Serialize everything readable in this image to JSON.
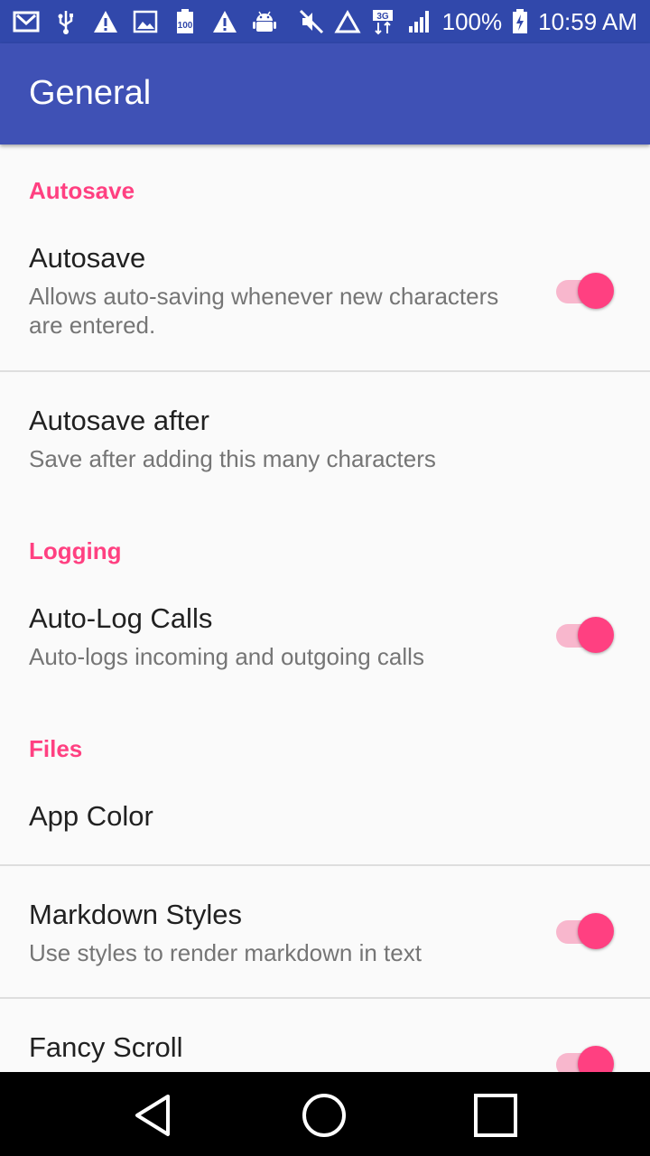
{
  "status_bar": {
    "left_icons": [
      "gmail-icon",
      "usb-icon",
      "warning-icon",
      "image-icon",
      "battery-100-icon",
      "warning-icon",
      "android-icon"
    ],
    "right_icons": [
      "mute-icon",
      "signal-triangle-icon",
      "3g-data-icon",
      "signal-bars-icon"
    ],
    "network_type": "3G",
    "battery_percent": "100%",
    "time": "10:59 AM"
  },
  "app_bar": {
    "title": "General"
  },
  "sections": [
    {
      "header": "Autosave",
      "items": [
        {
          "title": "Autosave",
          "summary": "Allows auto-saving whenever new characters are entered.",
          "switch_on": true
        },
        {
          "title": "Autosave after",
          "summary": "Save after adding this many characters"
        }
      ]
    },
    {
      "header": "Logging",
      "items": [
        {
          "title": "Auto-Log Calls",
          "summary": "Auto-logs incoming and outgoing calls",
          "switch_on": true
        }
      ]
    },
    {
      "header": "Files",
      "items": [
        {
          "title": "App Color"
        },
        {
          "title": "Markdown Styles",
          "summary": "Use styles to render markdown in text",
          "switch_on": true
        },
        {
          "title": "Fancy Scroll",
          "switch_on": true
        }
      ]
    }
  ],
  "nav_bar": {
    "buttons": [
      "back-icon",
      "home-icon",
      "recents-icon"
    ]
  },
  "colors": {
    "status_bar": "#3148ab",
    "app_bar": "#3f51b5",
    "accent": "#ff4081",
    "switch_track": "#f8b7cd",
    "background": "#fafafa"
  }
}
